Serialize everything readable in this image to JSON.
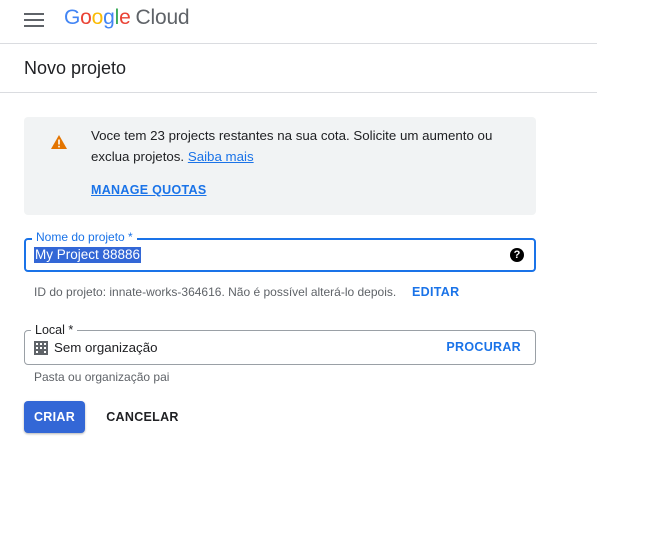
{
  "header": {
    "logo_letters": [
      "G",
      "o",
      "o",
      "g",
      "l",
      "e"
    ],
    "logo_product": "Cloud"
  },
  "page": {
    "title": "Novo projeto"
  },
  "quota_notice": {
    "text": "Voce tem 23 projects restantes na sua cota. Solicite um aumento ou exclua projetos.",
    "link": "Saiba mais",
    "action": "MANAGE QUOTAS",
    "icon": "warning-icon",
    "icon_color": "#e37400"
  },
  "project_name": {
    "label": "Nome do projeto *",
    "value": "My Project 88886",
    "help_icon": "help-icon"
  },
  "project_id": {
    "text": "ID do projeto: innate-works-364616. Não é possível alterá-lo depois.",
    "edit_label": "EDITAR"
  },
  "location": {
    "label": "Local *",
    "value": "Sem organização",
    "browse_label": "PROCURAR",
    "hint": "Pasta ou organização pai",
    "icon": "building-icon"
  },
  "actions": {
    "create_label": "CRIAR",
    "cancel_label": "CANCELAR"
  },
  "colors": {
    "accent": "#1a73e8",
    "primary_button": "#3367d6",
    "notice_bg": "#f1f3f4"
  }
}
